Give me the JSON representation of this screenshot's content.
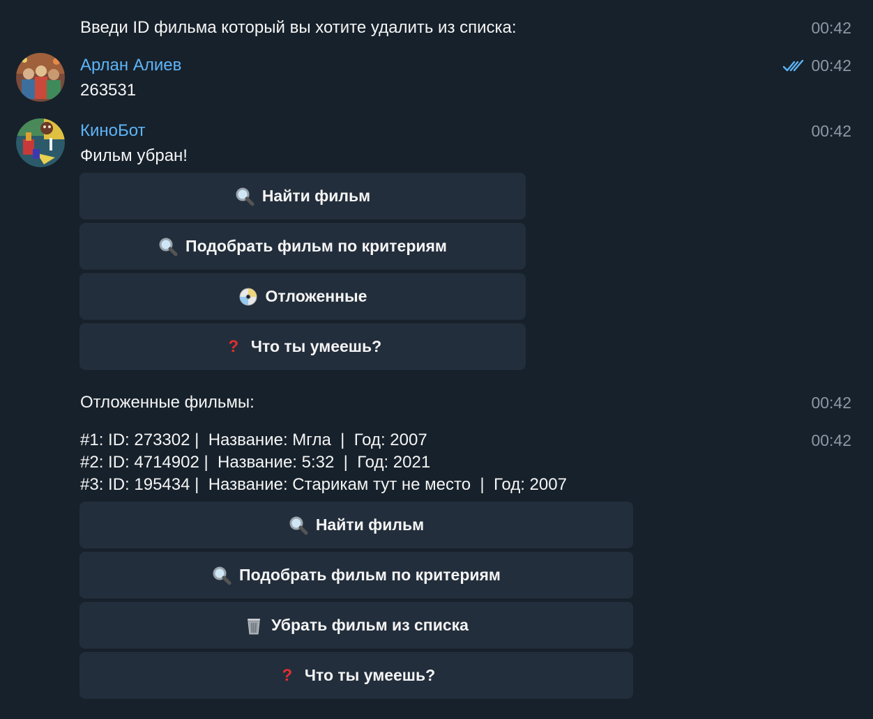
{
  "messages": {
    "prompt": {
      "text": "Введи ID фильма который вы хотите удалить из списка:",
      "time": "00:42"
    },
    "user": {
      "sender": "Арлан Алиев",
      "text": "263531",
      "time": "00:42"
    },
    "bot": {
      "sender": "КиноБот",
      "text": "Фильм убран!",
      "time": "00:42"
    },
    "deferred_header": {
      "text": "Отложенные фильмы:",
      "time": "00:42"
    },
    "deferred_list": {
      "time": "00:42",
      "lines": [
        "#1: ID: 273302 |  Название: Мгла  |  Год: 2007",
        "#2: ID: 4714902 |  Название: 5:32  |  Год: 2021",
        "#3: ID: 195434 |  Название: Старикам тут не место  |  Год: 2007"
      ]
    }
  },
  "keyboard1": {
    "buttons": [
      {
        "label": "Найти фильм",
        "icon": "magnifier-icon"
      },
      {
        "label": "Подобрать фильм по критериям",
        "icon": "magnifier-icon"
      },
      {
        "label": "Отложенные",
        "icon": "dvd-icon"
      },
      {
        "label": "Что ты умеешь?",
        "icon": "question-mark-icon"
      }
    ]
  },
  "keyboard2": {
    "buttons": [
      {
        "label": "Найти фильм",
        "icon": "magnifier-icon"
      },
      {
        "label": "Подобрать фильм по критериям",
        "icon": "magnifier-icon"
      },
      {
        "label": "Убрать фильм из списка",
        "icon": "wastebasket-icon"
      },
      {
        "label": "Что ты умеешь?",
        "icon": "question-mark-icon"
      }
    ]
  },
  "colors": {
    "background": "#17212b",
    "button": "#232e3c",
    "sender": "#5eb5f7",
    "time": "#8d98a5",
    "check": "#5eb5f7"
  }
}
